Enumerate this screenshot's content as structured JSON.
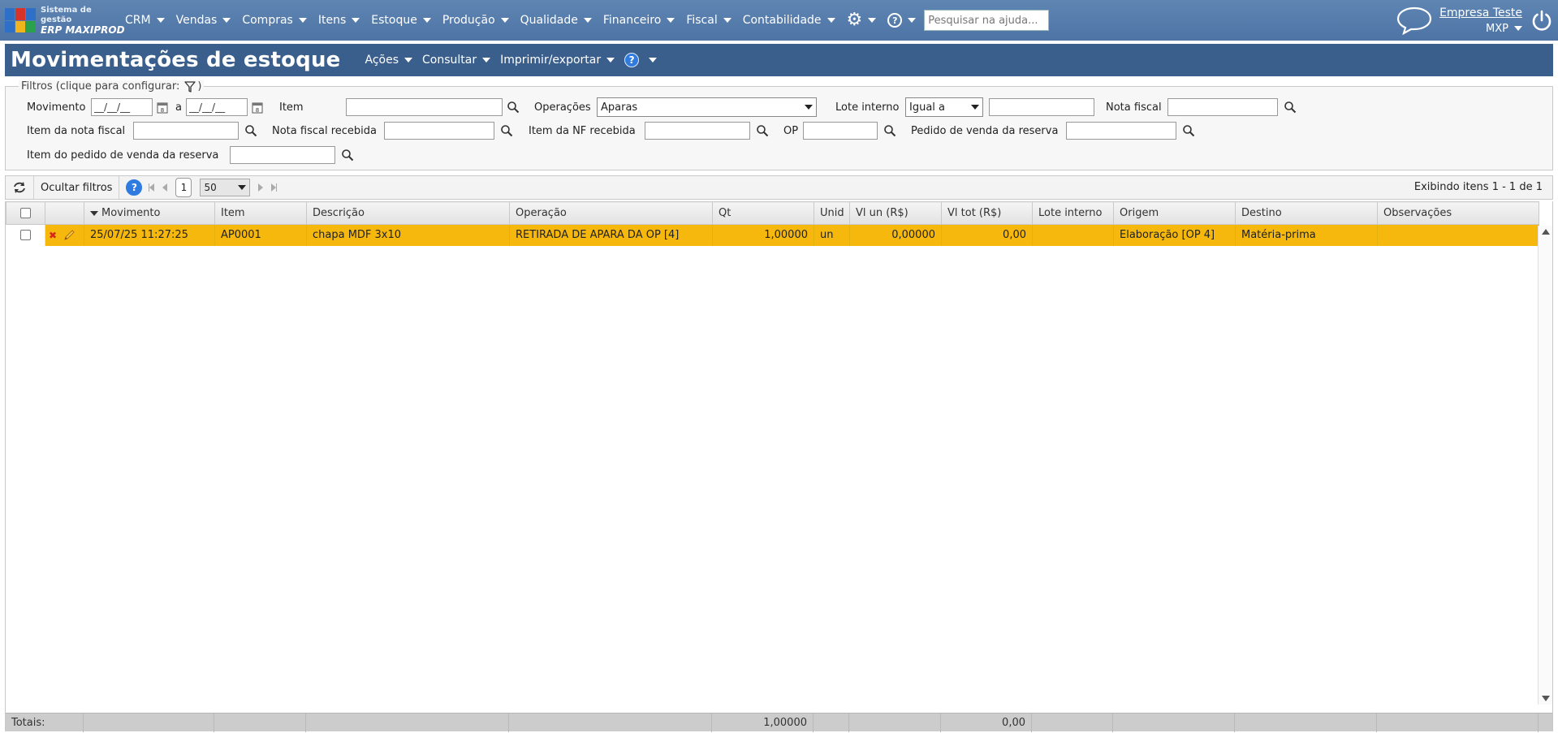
{
  "app": {
    "logo_line1": "Sistema de gestão",
    "logo_line2": "ERP MAXIPROD",
    "menu": [
      "CRM",
      "Vendas",
      "Compras",
      "Itens",
      "Estoque",
      "Produção",
      "Qualidade",
      "Financeiro",
      "Fiscal",
      "Contabilidade"
    ],
    "help_search_placeholder": "Pesquisar na ajuda...",
    "company_name": "Empresa Teste",
    "company_code": "MXP",
    "icons": [
      "gear-icon",
      "help-icon",
      "chat-icon",
      "power-icon"
    ]
  },
  "page": {
    "title": "Movimentações de estoque",
    "menus": [
      "Ações",
      "Consultar",
      "Imprimir/exportar"
    ]
  },
  "filters": {
    "legend": "Filtros (clique para configurar:",
    "legend_end": ")",
    "movimento_label": "Movimento",
    "date_from": "__/__/__",
    "date_sep": "a",
    "date_to": "__/__/__",
    "item_label": "Item",
    "item_value": "",
    "operacoes_label": "Operações",
    "operacoes_value": "Aparas",
    "lote_label": "Lote interno",
    "lote_mode": "Igual a",
    "lote_value": "",
    "nota_fiscal_label": "Nota fiscal",
    "item_nf_label": "Item da nota fiscal",
    "nf_recebida_label": "Nota fiscal recebida",
    "item_nf_recebida_label": "Item da NF recebida",
    "op_label": "OP",
    "pedido_reserva_label": "Pedido de venda da reserva",
    "item_pedido_reserva_label": "Item do pedido de venda da reserva"
  },
  "toolbar": {
    "hide_filters": "Ocultar filtros",
    "page": "1",
    "page_size": "50",
    "showing": "Exibindo itens 1 - 1 de 1"
  },
  "table": {
    "columns": [
      "Movimento",
      "Item",
      "Descrição",
      "Operação",
      "Qt",
      "Unid",
      "Vl un (R$)",
      "Vl tot (R$)",
      "Lote interno",
      "Origem",
      "Destino",
      "Observações"
    ],
    "rows": [
      {
        "movimento": "25/07/25 11:27:25",
        "item": "AP0001",
        "descricao": "chapa MDF 3x10",
        "operacao": "RETIRADA DE APARA DA OP [4]",
        "qt": "1,00000",
        "unid": "un",
        "vl_un": "0,00000",
        "vl_tot": "0,00",
        "lote": "",
        "origem": "Elaboração [OP 4]",
        "destino": "Matéria-prima",
        "observacoes": ""
      }
    ],
    "totals_label": "Totais:",
    "totals_qt": "1,00000",
    "totals_vl_tot": "0,00"
  },
  "colors": {
    "topbar": "#5279aa",
    "header": "#3a5f8d",
    "selected_row": "#f6b80d"
  }
}
